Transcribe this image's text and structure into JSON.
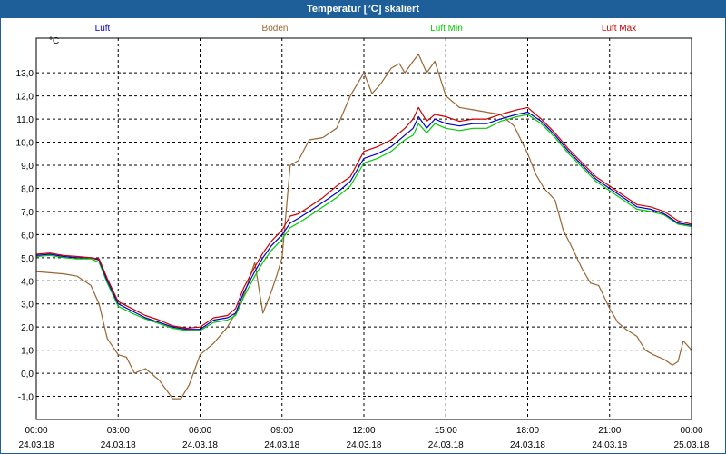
{
  "window": {
    "title": "Temperatur [°C] skaliert"
  },
  "chart_data": {
    "type": "line",
    "ylabel": "°C",
    "ylim": [
      -2.0,
      14.5
    ],
    "xlim": [
      0,
      24
    ],
    "yticks": [
      -1.0,
      0.0,
      1.0,
      2.0,
      3.0,
      4.0,
      5.0,
      6.0,
      7.0,
      8.0,
      9.0,
      10.0,
      11.0,
      12.0,
      13.0
    ],
    "yticklabels": [
      "-1,0",
      "0,0",
      "1,0",
      "2,0",
      "3,0",
      "4,0",
      "5,0",
      "6,0",
      "7,0",
      "8,0",
      "9,0",
      "10,0",
      "11,0",
      "12,0",
      "13,0"
    ],
    "xticks": [
      {
        "time": "00:00",
        "date": "24.03.18"
      },
      {
        "time": "03:00",
        "date": "24.03.18"
      },
      {
        "time": "06:00",
        "date": "24.03.18"
      },
      {
        "time": "09:00",
        "date": "24.03.18"
      },
      {
        "time": "12:00",
        "date": "24.03.18"
      },
      {
        "time": "15:00",
        "date": "24.03.18"
      },
      {
        "time": "18:00",
        "date": "24.03.18"
      },
      {
        "time": "21:00",
        "date": "24.03.18"
      },
      {
        "time": "00:00",
        "date": "25.03.18"
      }
    ],
    "grid": true,
    "legend_position": "top",
    "series": [
      {
        "name": "Luft",
        "color": "#0000cc",
        "x": [
          0,
          0.5,
          1,
          1.5,
          2,
          2.3,
          2.6,
          3,
          3.5,
          4,
          4.5,
          5,
          5.5,
          6,
          6.5,
          7,
          7.3,
          7.6,
          8,
          8.3,
          8.6,
          9,
          9.3,
          9.6,
          10,
          10.5,
          11,
          11.5,
          12,
          12.5,
          13,
          13.5,
          13.8,
          14,
          14.3,
          14.6,
          15,
          15.5,
          16,
          16.5,
          17,
          17.3,
          17.6,
          18,
          18.5,
          19,
          19.5,
          20,
          20.5,
          21,
          21.5,
          22,
          22.5,
          23,
          23.5,
          24
        ],
        "y": [
          5.1,
          5.15,
          5.05,
          5.0,
          5.0,
          4.9,
          4.0,
          3.0,
          2.7,
          2.4,
          2.2,
          2.0,
          1.9,
          1.9,
          2.3,
          2.4,
          2.6,
          3.5,
          4.4,
          5.0,
          5.5,
          6.0,
          6.5,
          6.7,
          7.0,
          7.4,
          7.8,
          8.3,
          9.3,
          9.5,
          9.8,
          10.3,
          10.6,
          11.1,
          10.6,
          11.0,
          10.8,
          10.7,
          10.8,
          10.8,
          11.0,
          11.1,
          11.2,
          11.3,
          10.9,
          10.3,
          9.6,
          9.0,
          8.4,
          8.0,
          7.6,
          7.2,
          7.1,
          6.9,
          6.5,
          6.4
        ]
      },
      {
        "name": "Boden",
        "color": "#996633",
        "x": [
          0,
          0.5,
          1,
          1.5,
          2,
          2.3,
          2.6,
          3,
          3.3,
          3.6,
          4,
          4.5,
          5,
          5.3,
          5.6,
          6,
          6.5,
          7,
          7.5,
          8,
          8.3,
          8.6,
          8.8,
          9,
          9.3,
          9.6,
          10,
          10.5,
          11,
          11.5,
          12,
          12.3,
          12.6,
          13,
          13.3,
          13.5,
          13.8,
          14,
          14.3,
          14.6,
          15,
          15.5,
          16,
          16.5,
          17,
          17.5,
          18,
          18.3,
          18.6,
          19,
          19.3,
          19.6,
          20,
          20.3,
          20.6,
          21,
          21.3,
          21.6,
          22,
          22.3,
          22.6,
          23,
          23.3,
          23.5,
          23.7,
          24
        ],
        "y": [
          4.4,
          4.35,
          4.3,
          4.2,
          3.8,
          3.0,
          1.5,
          0.8,
          0.7,
          0.0,
          0.2,
          -0.3,
          -1.1,
          -1.1,
          -0.5,
          0.8,
          1.3,
          2.0,
          3.0,
          4.8,
          2.6,
          3.5,
          4.2,
          5.0,
          9.0,
          9.2,
          10.1,
          10.2,
          10.6,
          12.0,
          13.0,
          12.1,
          12.5,
          13.2,
          13.4,
          13.0,
          13.5,
          13.8,
          13.0,
          13.5,
          12.0,
          11.5,
          11.4,
          11.3,
          11.2,
          10.7,
          9.5,
          8.6,
          8.0,
          7.5,
          6.2,
          5.5,
          4.5,
          3.9,
          3.8,
          2.8,
          2.2,
          1.9,
          1.6,
          1.0,
          0.8,
          0.6,
          0.35,
          0.5,
          1.4,
          1.0
        ]
      },
      {
        "name": "Luft Min",
        "color": "#00cc00",
        "x": [
          0,
          0.5,
          1,
          1.5,
          2,
          2.3,
          2.6,
          3,
          3.5,
          4,
          4.5,
          5,
          5.5,
          6,
          6.5,
          7,
          7.3,
          7.6,
          8,
          8.3,
          8.6,
          9,
          9.3,
          9.6,
          10,
          10.5,
          11,
          11.5,
          12,
          12.5,
          13,
          13.5,
          13.8,
          14,
          14.3,
          14.6,
          15,
          15.5,
          16,
          16.5,
          17,
          17.3,
          17.6,
          18,
          18.5,
          19,
          19.5,
          20,
          20.5,
          21,
          21.5,
          22,
          22.5,
          23,
          23.5,
          24
        ],
        "y": [
          5.05,
          5.1,
          5.0,
          4.95,
          4.95,
          4.8,
          3.9,
          2.9,
          2.6,
          2.35,
          2.15,
          1.95,
          1.85,
          1.85,
          2.2,
          2.3,
          2.5,
          3.3,
          4.2,
          4.8,
          5.3,
          5.8,
          6.3,
          6.5,
          6.8,
          7.2,
          7.6,
          8.1,
          9.1,
          9.3,
          9.6,
          10.1,
          10.3,
          10.8,
          10.4,
          10.8,
          10.6,
          10.5,
          10.6,
          10.6,
          10.9,
          11.0,
          11.1,
          11.2,
          10.8,
          10.2,
          9.5,
          8.9,
          8.3,
          7.9,
          7.5,
          7.1,
          7.0,
          6.85,
          6.45,
          6.35
        ]
      },
      {
        "name": "Luft Max",
        "color": "#cc0000",
        "x": [
          0,
          0.5,
          1,
          1.5,
          2,
          2.3,
          2.6,
          3,
          3.5,
          4,
          4.5,
          5,
          5.5,
          6,
          6.5,
          7,
          7.3,
          7.6,
          8,
          8.3,
          8.6,
          9,
          9.3,
          9.6,
          10,
          10.5,
          11,
          11.5,
          12,
          12.5,
          13,
          13.5,
          13.8,
          14,
          14.3,
          14.6,
          15,
          15.5,
          16,
          16.5,
          17,
          17.3,
          17.6,
          18,
          18.5,
          19,
          19.5,
          20,
          20.5,
          21,
          21.5,
          22,
          22.5,
          23,
          23.5,
          24
        ],
        "y": [
          5.15,
          5.2,
          5.1,
          5.05,
          5.0,
          4.95,
          4.1,
          3.1,
          2.8,
          2.5,
          2.3,
          2.05,
          1.95,
          2.0,
          2.4,
          2.5,
          2.8,
          3.7,
          4.6,
          5.2,
          5.7,
          6.2,
          6.8,
          6.9,
          7.2,
          7.6,
          8.1,
          8.5,
          9.6,
          9.8,
          10.1,
          10.6,
          11.0,
          11.5,
          10.9,
          11.2,
          11.1,
          10.9,
          11.0,
          11.0,
          11.2,
          11.3,
          11.4,
          11.5,
          11.0,
          10.4,
          9.7,
          9.1,
          8.5,
          8.1,
          7.7,
          7.3,
          7.2,
          7.0,
          6.6,
          6.45
        ]
      }
    ]
  }
}
